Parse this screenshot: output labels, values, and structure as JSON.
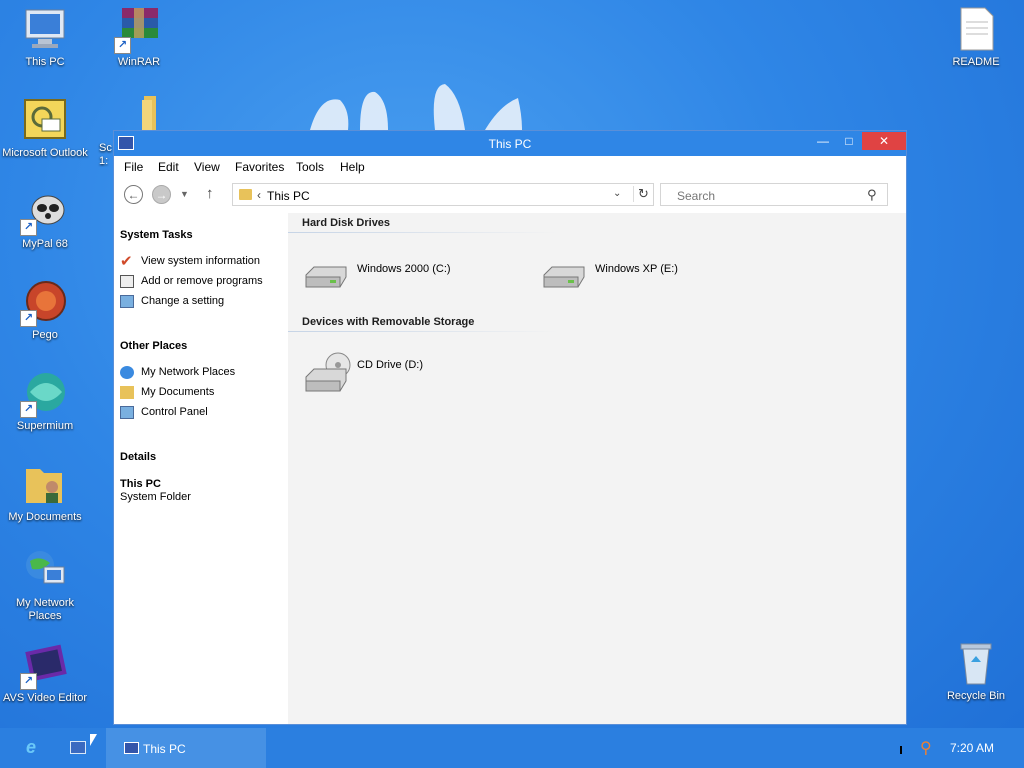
{
  "desktop": {
    "icons": [
      {
        "label": "This PC"
      },
      {
        "label": "WinRAR"
      },
      {
        "label": "README"
      },
      {
        "label": "Microsoft Outlook"
      },
      {
        "label": "Sc\n1:"
      },
      {
        "label": "MyPal 68"
      },
      {
        "label": "Pego"
      },
      {
        "label": "Supermium"
      },
      {
        "label": "My Documents"
      },
      {
        "label": "My Network Places"
      },
      {
        "label": "AVS Video Editor"
      },
      {
        "label": "Recycle Bin"
      }
    ]
  },
  "window": {
    "title": "This PC",
    "menu": [
      "File",
      "Edit",
      "View",
      "Favorites",
      "Tools",
      "Help"
    ],
    "address": {
      "chevron": "‹",
      "path": "This PC"
    },
    "search": {
      "placeholder": "Search"
    },
    "left_pane": {
      "system_tasks": {
        "title": "System Tasks",
        "items": [
          "View system information",
          "Add or remove programs",
          "Change a setting"
        ]
      },
      "other_places": {
        "title": "Other Places",
        "items": [
          "My Network Places",
          "My Documents",
          "Control Panel"
        ]
      },
      "details": {
        "title": "Details",
        "name": "This PC",
        "type": "System Folder"
      }
    },
    "groups": {
      "hard_disks": {
        "title": "Hard Disk Drives",
        "drives": [
          "Windows 2000 (C:)",
          "Windows XP (E:)"
        ]
      },
      "removable": {
        "title": "Devices with Removable Storage",
        "drives": [
          "CD Drive (D:)"
        ]
      }
    }
  },
  "taskbar": {
    "task_label": "This PC",
    "clock": "7:20 AM"
  },
  "colors": {
    "desktop": "#2f86e6",
    "close_button": "#e04343",
    "taskbar": "#2b7fe0"
  }
}
